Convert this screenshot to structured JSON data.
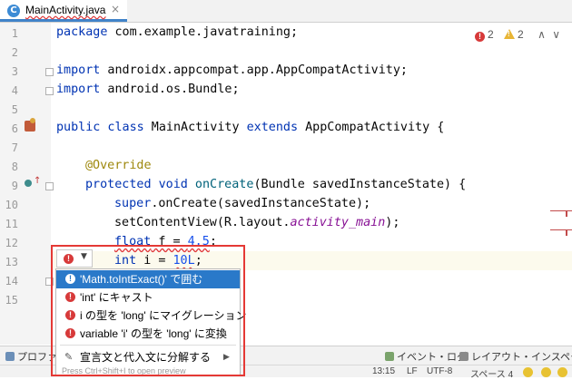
{
  "tab": {
    "icon": "C",
    "filename": "MainActivity.java",
    "close": "×"
  },
  "gutter": {
    "lines": [
      "1",
      "2",
      "3",
      "4",
      "5",
      "6",
      "7",
      "8",
      "9",
      "10",
      "11",
      "12",
      "13",
      "14",
      "15"
    ]
  },
  "code": {
    "l1_kw": "package",
    "l1_rest": " com.example.javatraining;",
    "l3_kw": "import",
    "l3_rest": " androidx.appcompat.app.AppCompatActivity;",
    "l4_kw": "import",
    "l4_rest": " android.os.Bundle;",
    "l6_kw1": "public class",
    "l6_name": " MainActivity ",
    "l6_kw2": "extends",
    "l6_rest": " AppCompatActivity {",
    "l8_ann": "@Override",
    "l9_kw": "protected void",
    "l9_fn": " onCreate",
    "l9_rest": "(Bundle savedInstanceState) {",
    "l10_kw": "super",
    "l10_rest": ".onCreate(savedInstanceState);",
    "l11_a": "setContentView(R.layout.",
    "l11_it": "activity_main",
    "l11_b": ");",
    "l12_kw": "float",
    "l12_a": " f = ",
    "l12_num": "4.5",
    "l12_b": ";",
    "l13_kw": "int",
    "l13_a": " i = ",
    "l13_num": "10L",
    "l13_b": ";"
  },
  "inspection": {
    "errors": "2",
    "warnings": "2",
    "up": "∧",
    "down": "∨"
  },
  "popup": {
    "items": [
      "'Math.toIntExact()' で囲む",
      "'int' にキャスト",
      "i の型を 'long' にマイグレーション",
      "variable 'i' の型を 'long' に変換"
    ],
    "split": "宣言文と代入文に分解する",
    "hint": "Press Ctrl+Shift+I to open preview"
  },
  "toolwindows": {
    "profiler": "プロファイラ",
    "event_log": "イベント・ログ",
    "layout_inspector": "レイアウト・インスペクター"
  },
  "status": {
    "pos": "13:15",
    "lf": "LF",
    "encoding": "UTF-8",
    "indent": "スペース 4"
  },
  "colors": {
    "accent": "#2a79c9",
    "error": "#d73a3a",
    "warning": "#e8b535",
    "keyword": "#0033b3"
  }
}
